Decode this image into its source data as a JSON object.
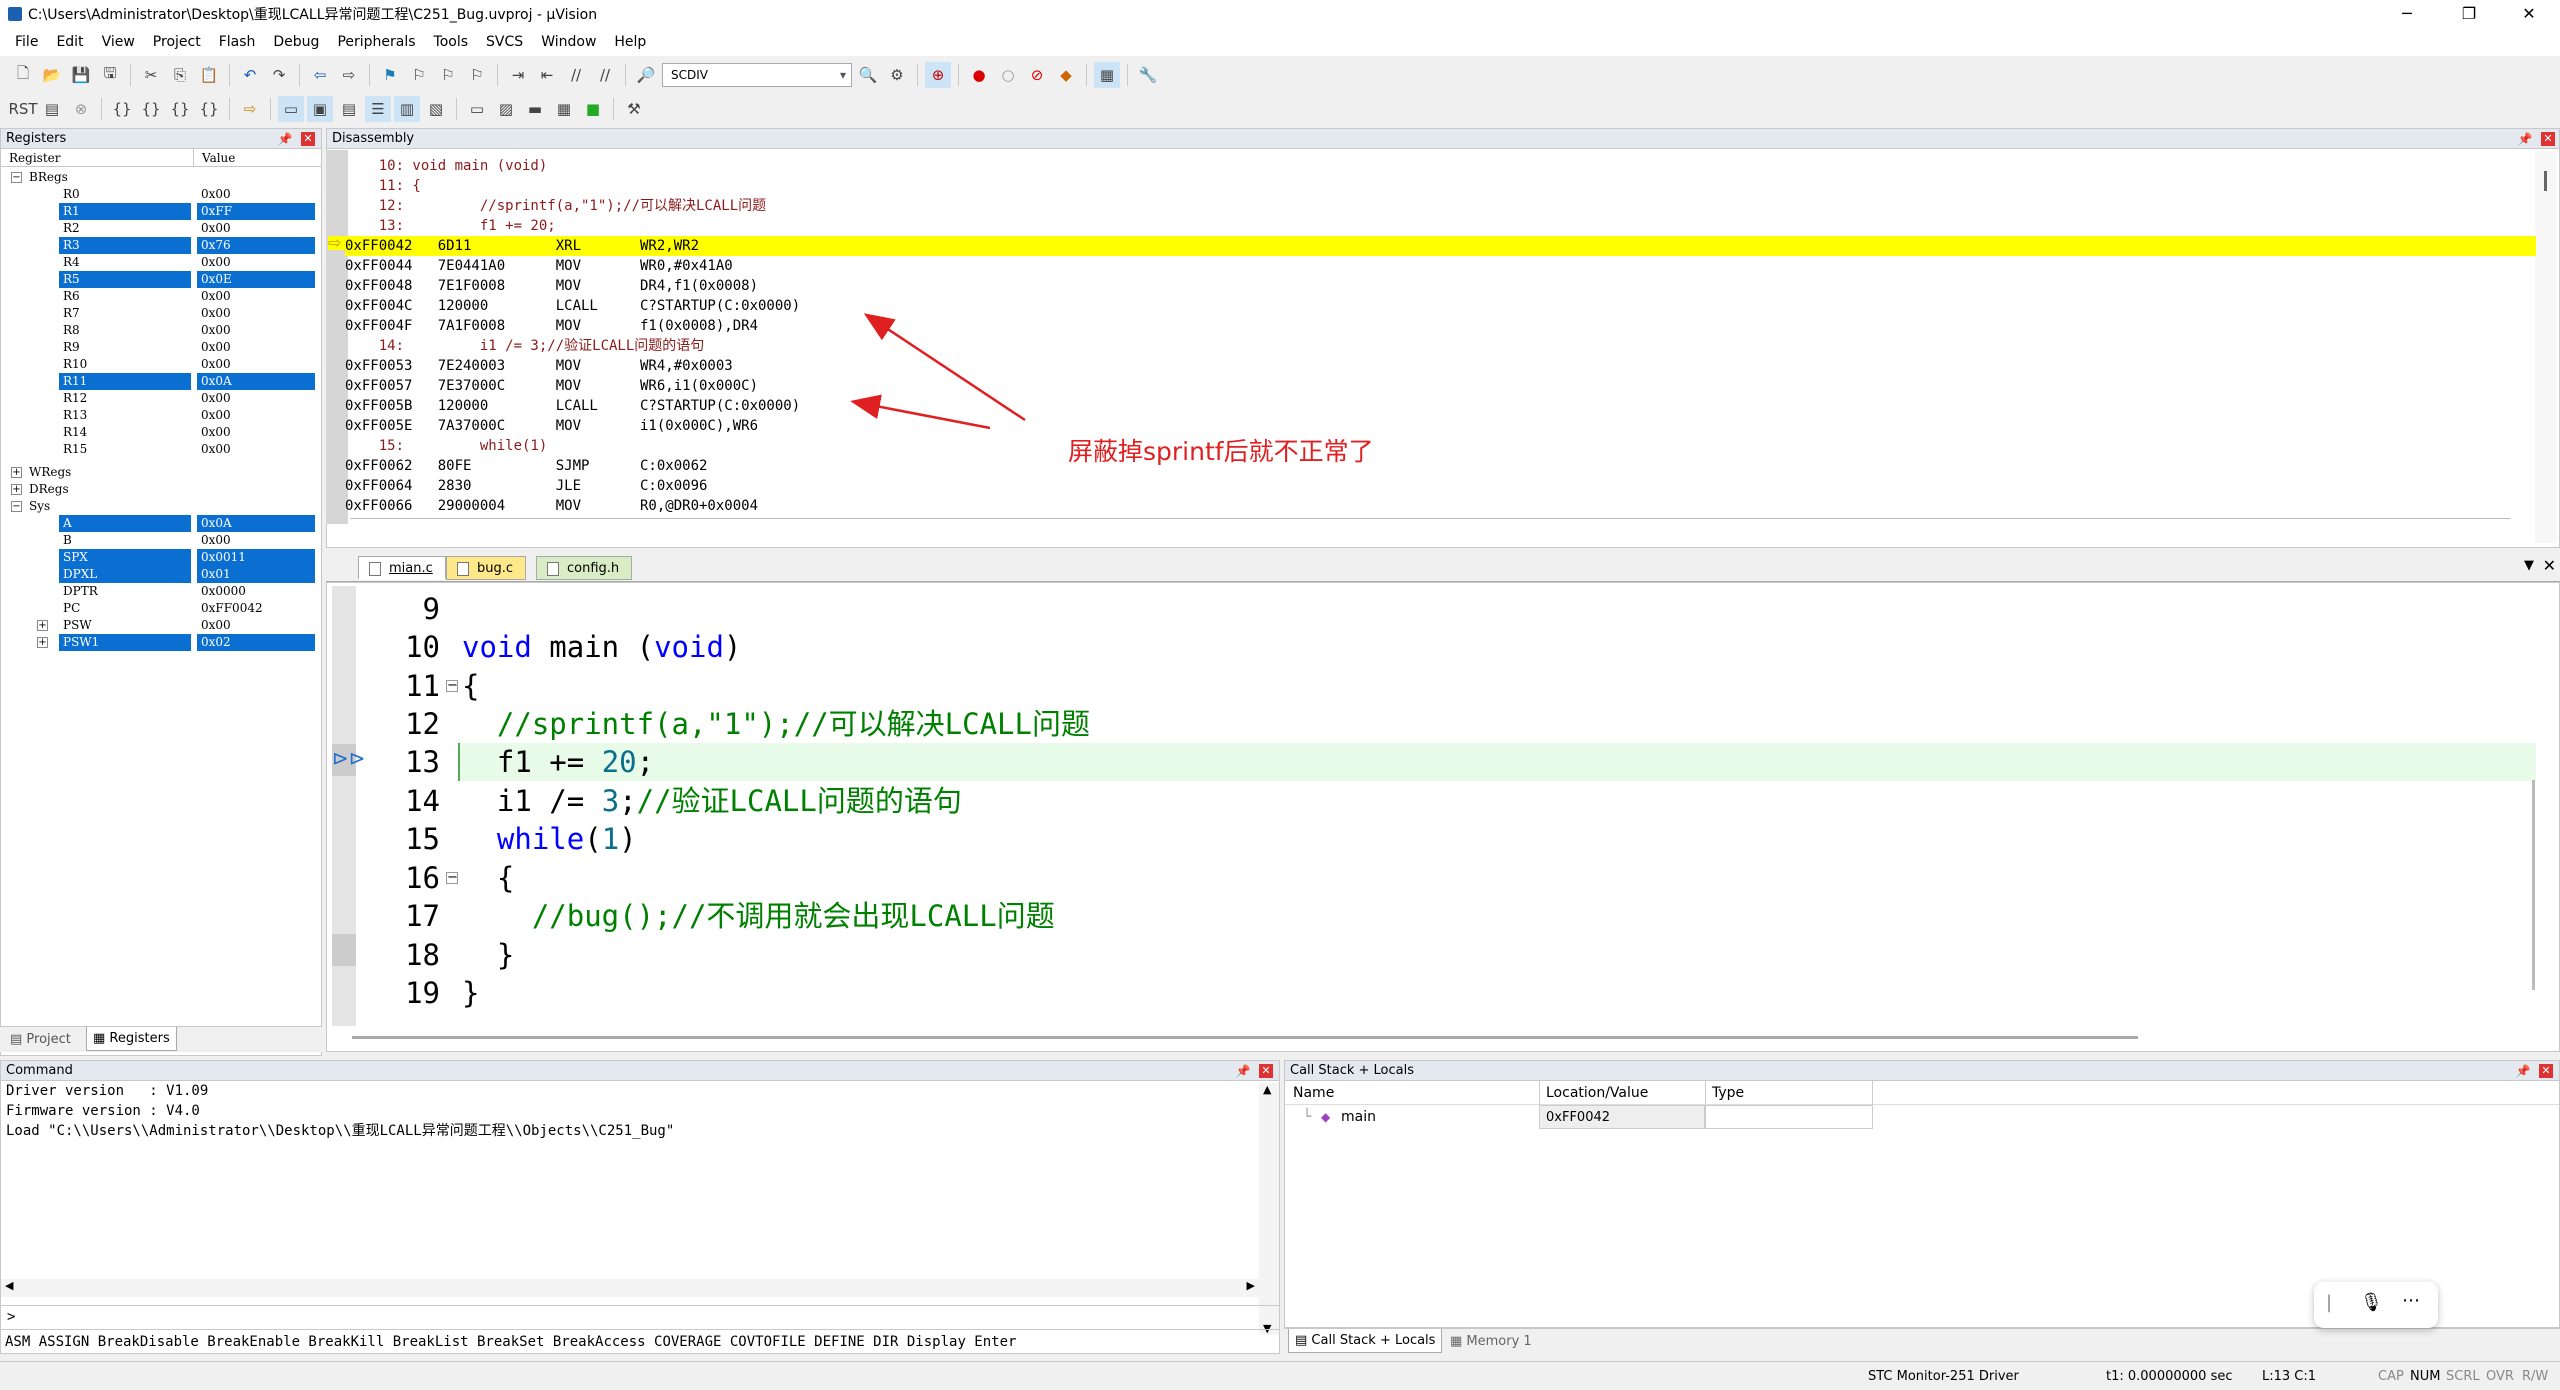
{
  "window": {
    "title": "C:\\Users\\Administrator\\Desktop\\重现LCALL异常问题工程\\C251_Bug.uvproj - µVision",
    "minimize": "─",
    "maximize": "❐",
    "close": "✕"
  },
  "menu": [
    "File",
    "Edit",
    "View",
    "Project",
    "Flash",
    "Debug",
    "Peripherals",
    "Tools",
    "SVCS",
    "Window",
    "Help"
  ],
  "toolbar": {
    "target_combo": "SCDIV"
  },
  "registers": {
    "title": "Registers",
    "col_register": "Register",
    "col_value": "Value",
    "groups": {
      "bregs": "BRegs",
      "wregs": "WRegs",
      "dregs": "DRegs",
      "sys": "Sys"
    },
    "bregs": [
      {
        "name": "R0",
        "value": "0x00",
        "sel": false
      },
      {
        "name": "R1",
        "value": "0xFF",
        "sel": true
      },
      {
        "name": "R2",
        "value": "0x00",
        "sel": false
      },
      {
        "name": "R3",
        "value": "0x76",
        "sel": true
      },
      {
        "name": "R4",
        "value": "0x00",
        "sel": false
      },
      {
        "name": "R5",
        "value": "0x0E",
        "sel": true
      },
      {
        "name": "R6",
        "value": "0x00",
        "sel": false
      },
      {
        "name": "R7",
        "value": "0x00",
        "sel": false
      },
      {
        "name": "R8",
        "value": "0x00",
        "sel": false
      },
      {
        "name": "R9",
        "value": "0x00",
        "sel": false
      },
      {
        "name": "R10",
        "value": "0x00",
        "sel": false
      },
      {
        "name": "R11",
        "value": "0x0A",
        "sel": true
      },
      {
        "name": "R12",
        "value": "0x00",
        "sel": false
      },
      {
        "name": "R13",
        "value": "0x00",
        "sel": false
      },
      {
        "name": "R14",
        "value": "0x00",
        "sel": false
      },
      {
        "name": "R15",
        "value": "0x00",
        "sel": false
      }
    ],
    "sys": [
      {
        "name": "A",
        "value": "0x0A",
        "sel": true
      },
      {
        "name": "B",
        "value": "0x00",
        "sel": false
      },
      {
        "name": "SPX",
        "value": "0x0011",
        "sel": true
      },
      {
        "name": "DPXL",
        "value": "0x01",
        "sel": true
      },
      {
        "name": "DPTR",
        "value": "0x0000",
        "sel": false
      },
      {
        "name": "PC",
        "value": "0xFF0042",
        "sel": false
      },
      {
        "name": "PSW",
        "value": "0x00",
        "sel": false
      },
      {
        "name": "PSW1",
        "value": "0x02",
        "sel": true
      }
    ],
    "tab_project": "Project",
    "tab_registers": "Registers"
  },
  "disassembly": {
    "title": "Disassembly",
    "lines": [
      {
        "t": "    10: void main (void)",
        "k": "src"
      },
      {
        "t": "    11: {",
        "k": "src"
      },
      {
        "t": "    12:         //sprintf(a,\"1\");//可以解决LCALL问题",
        "k": "src"
      },
      {
        "t": "    13:         f1 += 20;",
        "k": "src"
      },
      {
        "t": "0xFF0042   6D11          XRL       WR2,WR2",
        "k": "cur"
      },
      {
        "t": "0xFF0044   7E0441A0      MOV       WR0,#0x41A0",
        "k": "asm"
      },
      {
        "t": "0xFF0048   7E1F0008      MOV       DR4,f1(0x0008)",
        "k": "asm"
      },
      {
        "t": "0xFF004C   120000        LCALL     C?STARTUP(C:0x0000)",
        "k": "asm"
      },
      {
        "t": "0xFF004F   7A1F0008      MOV       f1(0x0008),DR4",
        "k": "asm"
      },
      {
        "t": "    14:         i1 /= 3;//验证LCALL问题的语句",
        "k": "src"
      },
      {
        "t": "0xFF0053   7E240003      MOV       WR4,#0x0003",
        "k": "asm"
      },
      {
        "t": "0xFF0057   7E37000C      MOV       WR6,i1(0x000C)",
        "k": "asm"
      },
      {
        "t": "0xFF005B   120000        LCALL     C?STARTUP(C:0x0000)",
        "k": "asm"
      },
      {
        "t": "0xFF005E   7A37000C      MOV       i1(0x000C),WR6",
        "k": "asm"
      },
      {
        "t": "    15:         while(1)",
        "k": "src"
      },
      {
        "t": "0xFF0062   80FE          SJMP      C:0x0062",
        "k": "asm"
      },
      {
        "t": "0xFF0064   2830          JLE       C:0x0096",
        "k": "asm"
      },
      {
        "t": "0xFF0066   29000004      MOV       R0,@DR0+0x0004",
        "k": "asm"
      }
    ],
    "annotation": "屏蔽掉sprintf后就不正常了"
  },
  "editor": {
    "tabs": [
      "mian.c",
      "bug.c",
      "config.h"
    ],
    "line_numbers": [
      "9",
      "10",
      "11",
      "12",
      "13",
      "14",
      "15",
      "16",
      "17",
      "18",
      "19"
    ],
    "lines": {
      "l10_kw": "void",
      "l10_a": " main (",
      "l10_b": "void",
      "l10_c": ")",
      "l11": "{",
      "l12": "  //sprintf(a,\"1\");//可以解决LCALL问题",
      "l13_a": "  f1 += ",
      "l13_num": "20",
      "l13_b": ";",
      "l14_a": "  i1 /= ",
      "l14_num": "3",
      "l14_b": ";",
      "l14_cmt": "//验证LCALL问题的语句",
      "l15_kw": "  while",
      "l15_a": "(",
      "l15_num": "1",
      "l15_b": ")",
      "l16": "  {",
      "l17": "    //bug();//不调用就会出现LCALL问题",
      "l18": "  }",
      "l19": "}"
    }
  },
  "command": {
    "title": "Command",
    "lines": [
      "Driver version   : V1.09",
      "Firmware version : V4.0",
      "Load \"C:\\\\Users\\\\Administrator\\\\Desktop\\\\重现LCALL异常问题工程\\\\Objects\\\\C251_Bug\""
    ],
    "prompt": ">",
    "keywords": "ASM ASSIGN BreakDisable BreakEnable BreakKill BreakList BreakSet BreakAccess COVERAGE COVTOFILE DEFINE DIR Display Enter"
  },
  "callstack": {
    "title": "Call Stack + Locals",
    "col_name": "Name",
    "col_location": "Location/Value",
    "col_type": "Type",
    "row_name": "main",
    "row_location": "0xFF0042",
    "row_type": "",
    "tab_callstack": "Call Stack + Locals",
    "tab_memory": "Memory 1"
  },
  "status": {
    "driver": "STC Monitor-251 Driver",
    "time": "t1: 0.00000000 sec",
    "pos": "L:13 C:1",
    "caps": "CAP",
    "num": "NUM",
    "scrl": "SCRL",
    "ovr": "OVR",
    "rw": "R/W"
  }
}
